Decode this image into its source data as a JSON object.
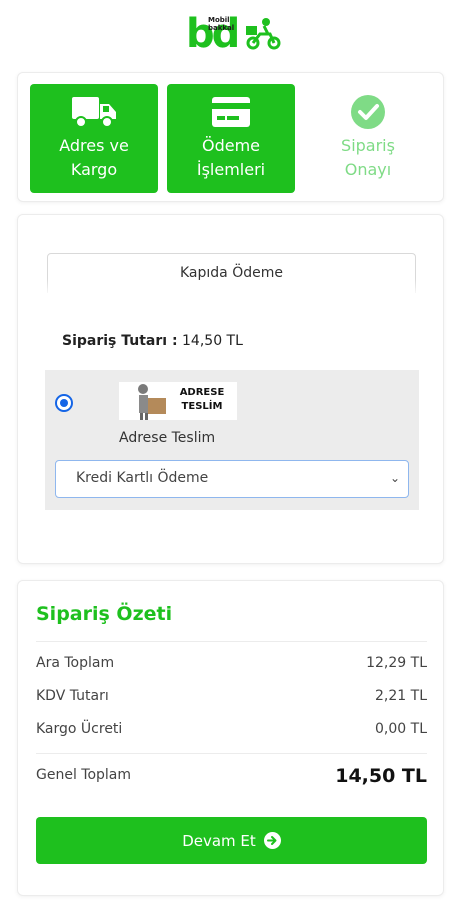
{
  "logo": {
    "letters": "bd",
    "small_text": "Mobil\nbakkal"
  },
  "steps": [
    {
      "label": "Adres ve\nKargo",
      "icon": "truck-icon",
      "state": "active"
    },
    {
      "label": "Ödeme\nİşlemleri",
      "icon": "credit-card-icon",
      "state": "active"
    },
    {
      "label": "Sipariş\nOnayı",
      "icon": "check-circle-icon",
      "state": "pending"
    }
  ],
  "payment": {
    "tab_label": "Kapıda Ödeme",
    "amount_label": "Sipariş Tutarı :",
    "amount_value": "14,50 TL",
    "option": {
      "selected": true,
      "image_text": "ADRESE\nTESLİM",
      "label": "Adrese Teslim",
      "select_value": "Kredi Kartlı Ödeme"
    }
  },
  "summary": {
    "title": "Sipariş Özeti",
    "rows": [
      {
        "label": "Ara Toplam",
        "value": "12,29 TL"
      },
      {
        "label": "KDV Tutarı",
        "value": "2,21 TL"
      },
      {
        "label": "Kargo Ücreti",
        "value": "0,00 TL"
      }
    ],
    "total_label": "Genel Toplam",
    "total_value": "14,50 TL",
    "continue_label": "Devam Et"
  },
  "colors": {
    "brand_green": "#1ec01e",
    "pending_green": "#7fdb86",
    "radio_blue": "#1565e6"
  }
}
